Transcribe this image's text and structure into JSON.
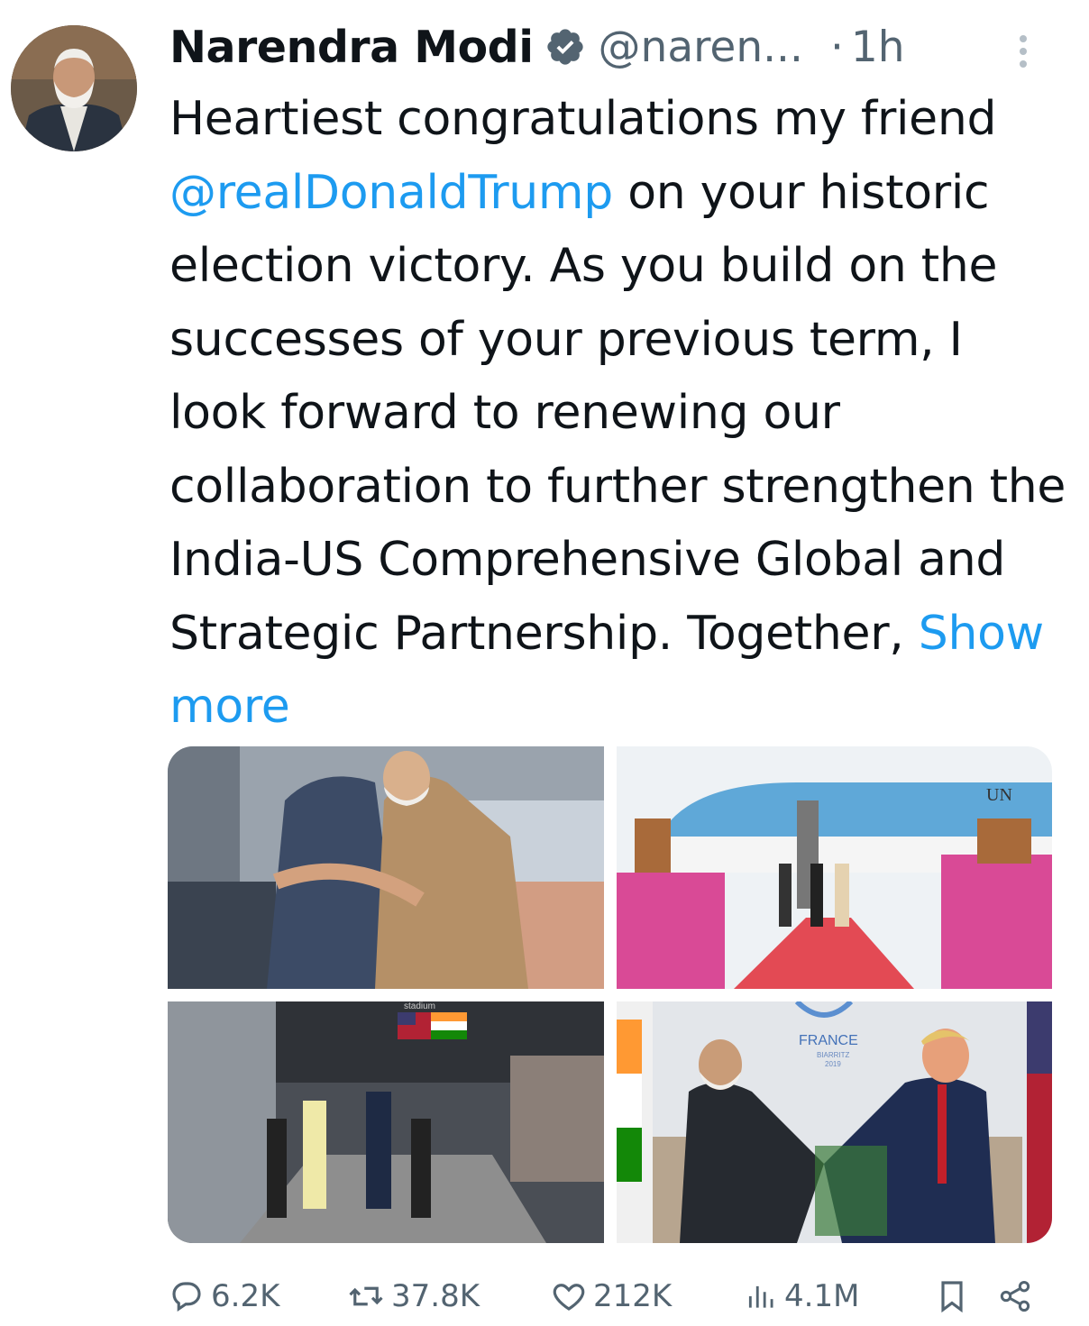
{
  "author": {
    "name": "Narendra Modi",
    "handle": "@naren...",
    "separator": "·",
    "time": "1h"
  },
  "tweet": {
    "text_before_mention": "Heartiest congratulations my friend ",
    "mention": "@realDonaldTrump",
    "text_after_mention": " on your historic election victory. As you build on the successes of your previous term, I look forward to renewing our collaboration to further strengthen the India-US Comprehensive Global and Strategic Partnership. Together, ",
    "show_more": "Show more"
  },
  "images": {
    "img3_banner": "stadium",
    "img4_logo_text": "FRANCE",
    "img4_logo_sub": "BIARRITZ",
    "img4_logo_year": "2019",
    "img2_plane_text": "UN"
  },
  "stats": {
    "replies": "6.2K",
    "reposts": "37.8K",
    "likes": "212K",
    "views": "4.1M"
  },
  "colors": {
    "link": "#1d9bf0",
    "muted": "#536471",
    "text": "#0f1419"
  }
}
